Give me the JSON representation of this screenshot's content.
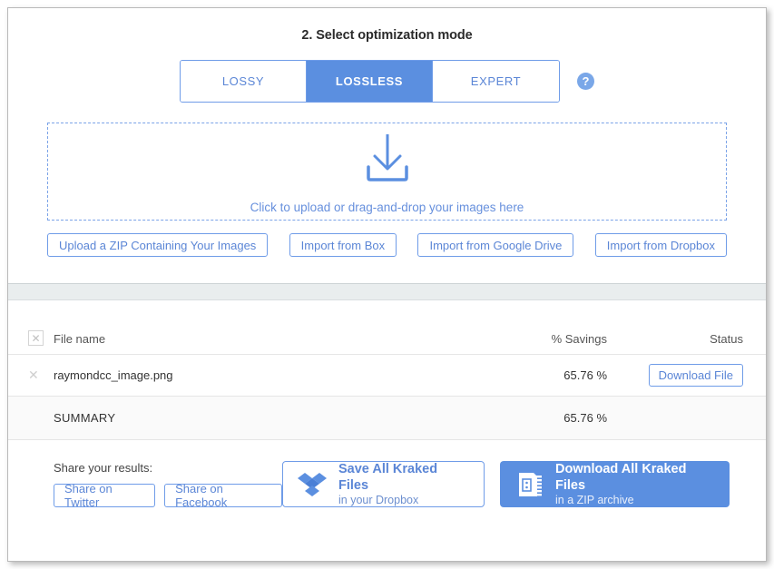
{
  "step": {
    "title": "2. Select optimization mode",
    "help_icon": "question-mark-icon",
    "modes": [
      {
        "label": "LOSSY",
        "active": false
      },
      {
        "label": "LOSSLESS",
        "active": true
      },
      {
        "label": "EXPERT",
        "active": false
      }
    ]
  },
  "dropzone": {
    "icon": "download-arrow-icon",
    "text": "Click to upload or drag-and-drop your images here"
  },
  "imports": [
    {
      "label": "Upload a ZIP Containing Your Images"
    },
    {
      "label": "Import from Box"
    },
    {
      "label": "Import from Google Drive"
    },
    {
      "label": "Import from Dropbox"
    }
  ],
  "table": {
    "clear_all_icon": "close-x-icon",
    "headers": {
      "file_name": "File name",
      "savings": "% Savings",
      "status": "Status"
    },
    "rows": [
      {
        "remove_icon": "close-x-icon",
        "file_name": "raymondcc_image.png",
        "savings": "65.76 %",
        "action": "Download File"
      }
    ],
    "summary": {
      "label": "SUMMARY",
      "savings": "65.76 %"
    }
  },
  "share": {
    "label": "Share your results:",
    "buttons": [
      {
        "label": "Share on Twitter"
      },
      {
        "label": "Share on Facebook"
      }
    ]
  },
  "actions": {
    "dropbox": {
      "icon": "dropbox-logo-icon",
      "main": "Save All Kraked Files",
      "sub": "in your Dropbox"
    },
    "zip": {
      "icon": "zip-archive-icon",
      "main": "Download All Kraked Files",
      "sub": "in a ZIP archive"
    }
  },
  "colors": {
    "accent_blue": "#5b8fe0",
    "outline_blue": "#6f9ce8",
    "link_blue": "#5b86d6",
    "band_grey": "#e9edee"
  }
}
